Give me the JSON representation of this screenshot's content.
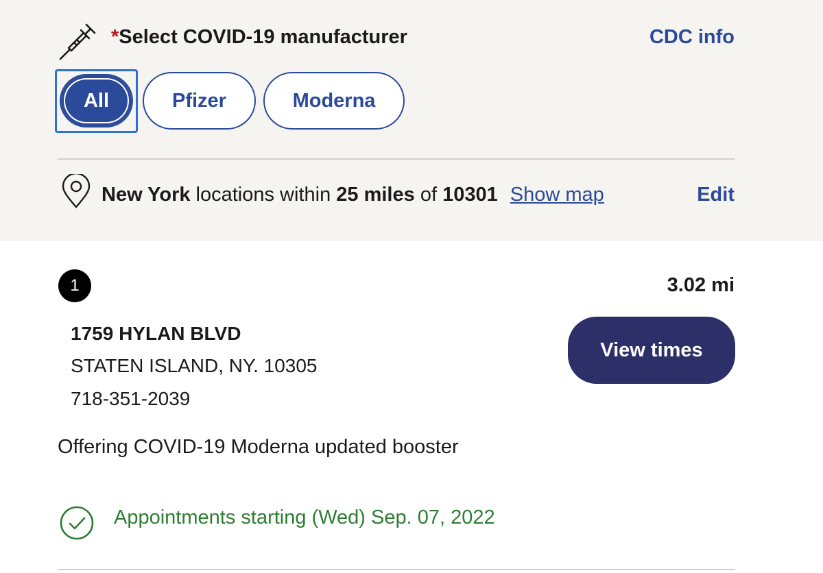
{
  "manufacturer_section": {
    "required_mark": "*",
    "title": "Select COVID-19 manufacturer",
    "cdc_link": "CDC info",
    "icon": "syringe-icon",
    "options": [
      {
        "label": "All",
        "selected": true
      },
      {
        "label": "Pfizer",
        "selected": false
      },
      {
        "label": "Moderna",
        "selected": false
      }
    ]
  },
  "location_summary": {
    "icon": "map-pin-icon",
    "city": "New York",
    "text_locations_within": "locations within",
    "radius": "25 miles",
    "text_of": "of",
    "zip": "10301",
    "show_map": "Show map",
    "edit": "Edit"
  },
  "results": [
    {
      "index": "1",
      "distance": "3.02 mi",
      "address_line1": "1759 HYLAN BLVD",
      "address_line2": "STATEN ISLAND, NY. 10305",
      "phone": "718-351-2039",
      "view_times": "View times",
      "offering": "Offering COVID-19 Moderna updated booster",
      "appointment": "Appointments starting (Wed) Sep. 07, 2022"
    }
  ],
  "colors": {
    "accent_blue": "#2c4a9a",
    "button_dark": "#2d3068",
    "required_red": "#c0131c",
    "success_green": "#2e7d32",
    "panel_bg": "#f5f4f0"
  }
}
